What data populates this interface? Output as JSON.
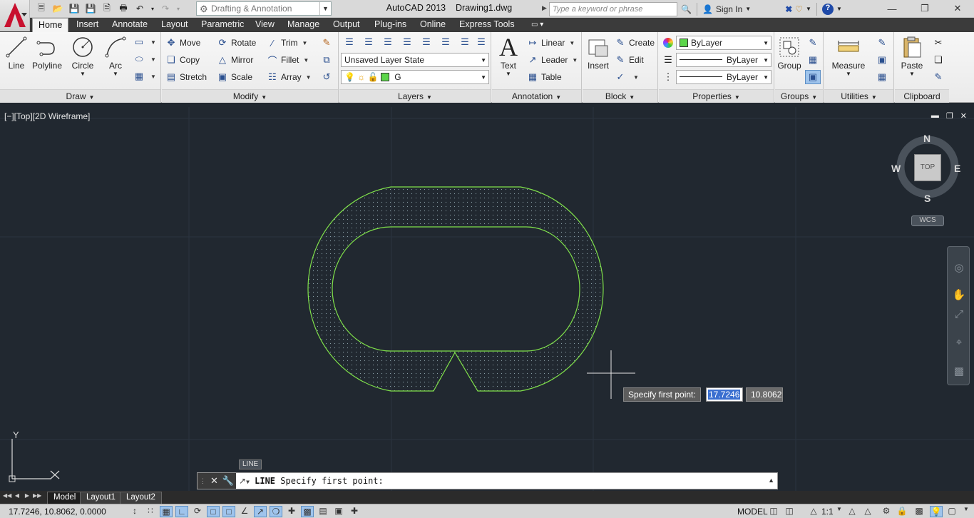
{
  "title_bar": {
    "workspace": "Drafting & Annotation",
    "app_name": "AutoCAD 2013",
    "document": "Drawing1.dwg",
    "search_placeholder": "Type a keyword or phrase",
    "sign_in": "Sign In"
  },
  "tabs": [
    "Home",
    "Insert",
    "Annotate",
    "Layout",
    "Parametric",
    "View",
    "Manage",
    "Output",
    "Plug-ins",
    "Online",
    "Express Tools"
  ],
  "active_tab": "Home",
  "ribbon": {
    "draw": {
      "title": "Draw",
      "line": "Line",
      "polyline": "Polyline",
      "circle": "Circle",
      "arc": "Arc"
    },
    "modify": {
      "title": "Modify",
      "move": "Move",
      "rotate": "Rotate",
      "trim": "Trim",
      "copy": "Copy",
      "mirror": "Mirror",
      "fillet": "Fillet",
      "stretch": "Stretch",
      "scale": "Scale",
      "array": "Array"
    },
    "layers": {
      "title": "Layers",
      "layer_state": "Unsaved Layer State",
      "current_layer": "G"
    },
    "annotation": {
      "title": "Annotation",
      "text": "Text",
      "linear": "Linear",
      "leader": "Leader",
      "table": "Table"
    },
    "block": {
      "title": "Block",
      "insert": "Insert",
      "create": "Create",
      "edit": "Edit"
    },
    "properties": {
      "title": "Properties",
      "color": "ByLayer",
      "lineweight": "ByLayer",
      "linetype": "ByLayer"
    },
    "groups": {
      "title": "Groups",
      "group": "Group"
    },
    "utilities": {
      "title": "Utilities",
      "measure": "Measure"
    },
    "clipboard": {
      "title": "Clipboard",
      "paste": "Paste"
    }
  },
  "viewport": {
    "label": "[−][Top][2D Wireframe]",
    "viewcube": {
      "n": "N",
      "s": "S",
      "e": "E",
      "w": "W",
      "face": "TOP"
    },
    "wcs": "WCS",
    "ucs_y": "Y",
    "dynamic_input": {
      "prompt": "Specify first point:",
      "x": "17.7246",
      "y": "10.8062"
    },
    "command_tag": "LINE"
  },
  "command_line": {
    "command": "LINE",
    "prompt": "Specify first point:"
  },
  "layout_tabs": [
    "Model",
    "Layout1",
    "Layout2"
  ],
  "status_bar": {
    "coordinates": "17.7246, 10.8062, 0.0000",
    "space": "MODEL",
    "scale": "1:1"
  },
  "colors": {
    "drawing_line": "#7fe04a",
    "viewport_bg": "#212830",
    "ribbon_bg": "#f0f0f0",
    "layer_color": "#5cd64a"
  }
}
